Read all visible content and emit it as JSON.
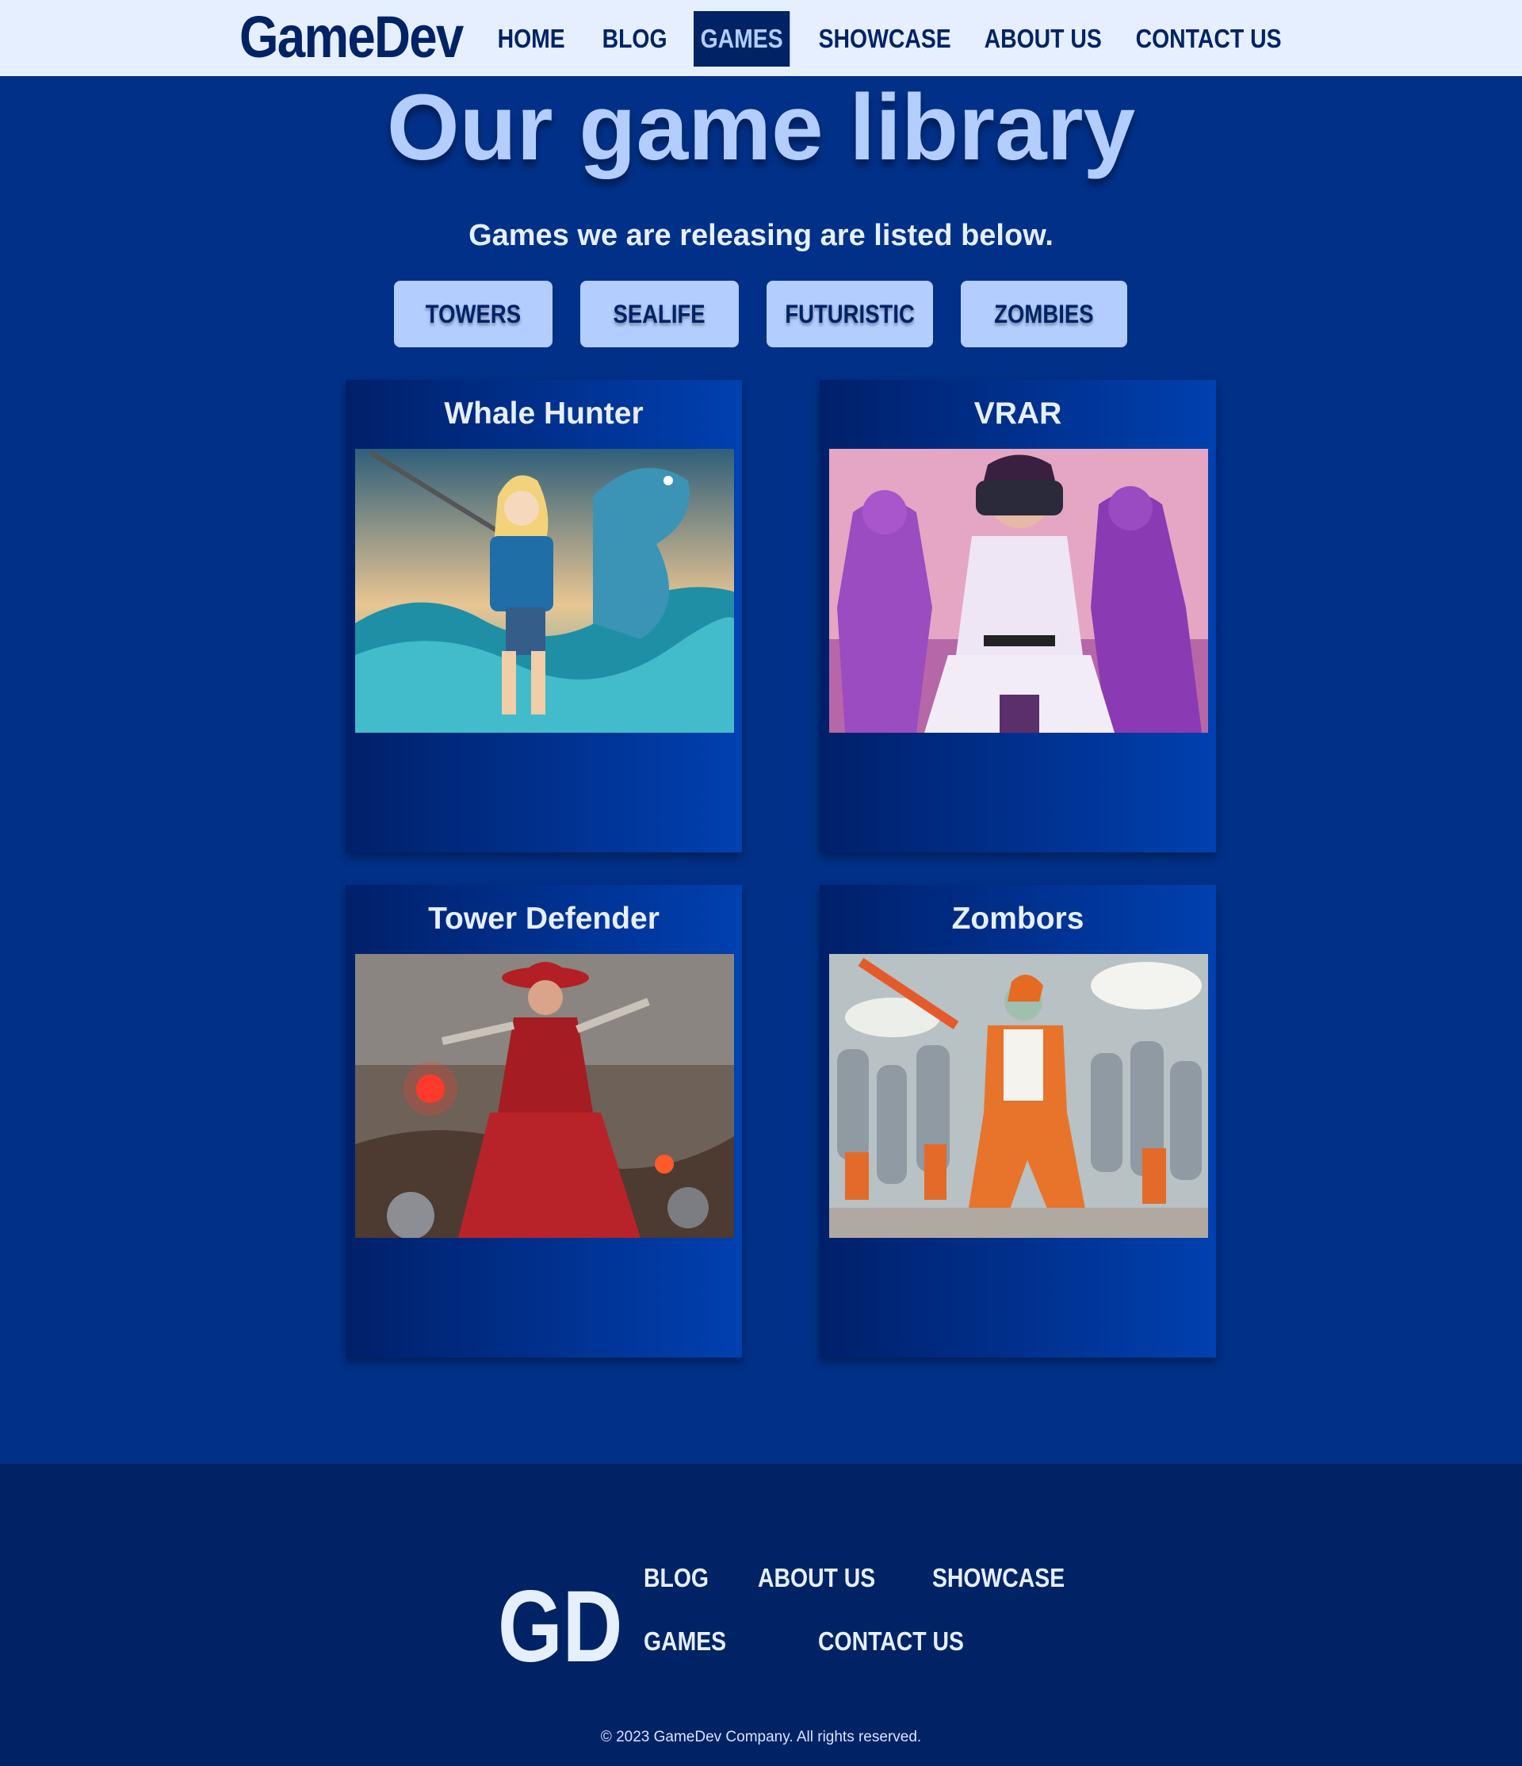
{
  "nav": {
    "brand": "GameDev",
    "links": [
      "HOME",
      "BLOG",
      "GAMES",
      "SHOWCASE",
      "ABOUT US",
      "CONTACT US"
    ],
    "active": "GAMES"
  },
  "hero": {
    "title": "Our game library",
    "subtitle": "Games we are releasing are listed below."
  },
  "filters": [
    "TOWERS",
    "SEALIFE",
    "FUTURISTIC",
    "ZOMBIES"
  ],
  "games": [
    {
      "title": "Whale Hunter",
      "image": "anime-girl-with-spear-and-sea-monster"
    },
    {
      "title": "VRAR",
      "image": "woman-in-vr-headset-with-purple-robots"
    },
    {
      "title": "Tower Defender",
      "image": "red-witch-warrior-in-battle"
    },
    {
      "title": "Zombors",
      "image": "orange-woman-with-bat-vs-zombie-horde"
    }
  ],
  "footer": {
    "logo": "GD",
    "links": [
      "BLOG",
      "ABOUT US",
      "SHOWCASE",
      "GAMES",
      "CONTACT US"
    ],
    "copyright": "© 2023 GameDev Company. All rights reserved."
  },
  "colors": {
    "page_bg": "#003087",
    "nav_bg": "#e6efff",
    "navy": "#002366",
    "accent": "#b3cdff",
    "light_text": "#e6efff"
  }
}
